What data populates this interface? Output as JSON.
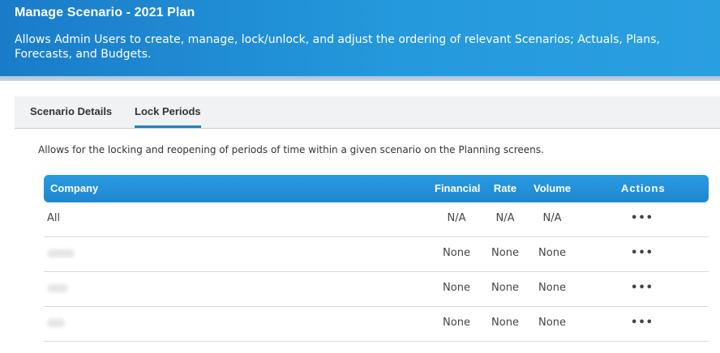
{
  "header": {
    "title": "Manage Scenario - 2021 Plan",
    "description": "Allows Admin Users to create, manage, lock/unlock, and adjust the ordering of relevant Scenarios; Actuals, Plans, Forecasts, and Budgets."
  },
  "tabs": [
    {
      "label": "Scenario Details",
      "active": false
    },
    {
      "label": "Lock Periods",
      "active": true
    }
  ],
  "intro": "Allows for the locking and reopening of periods of time within a given scenario on the Planning screens.",
  "table": {
    "columns": [
      "Company",
      "Financial",
      "Rate",
      "Volume",
      "Actions"
    ],
    "rows": [
      {
        "company": "All",
        "financial": "N/A",
        "rate": "N/A",
        "volume": "N/A",
        "actions": "•••"
      },
      {
        "company": "",
        "financial": "None",
        "rate": "None",
        "volume": "None",
        "actions": "•••"
      },
      {
        "company": "",
        "financial": "None",
        "rate": "None",
        "volume": "None",
        "actions": "•••"
      },
      {
        "company": "",
        "financial": "None",
        "rate": "None",
        "volume": "None",
        "actions": "•••"
      }
    ]
  },
  "colors": {
    "header_blue": "#1a7cc9",
    "tab_accent": "#1f7fc8",
    "table_header_blue": "#2a9be0"
  }
}
